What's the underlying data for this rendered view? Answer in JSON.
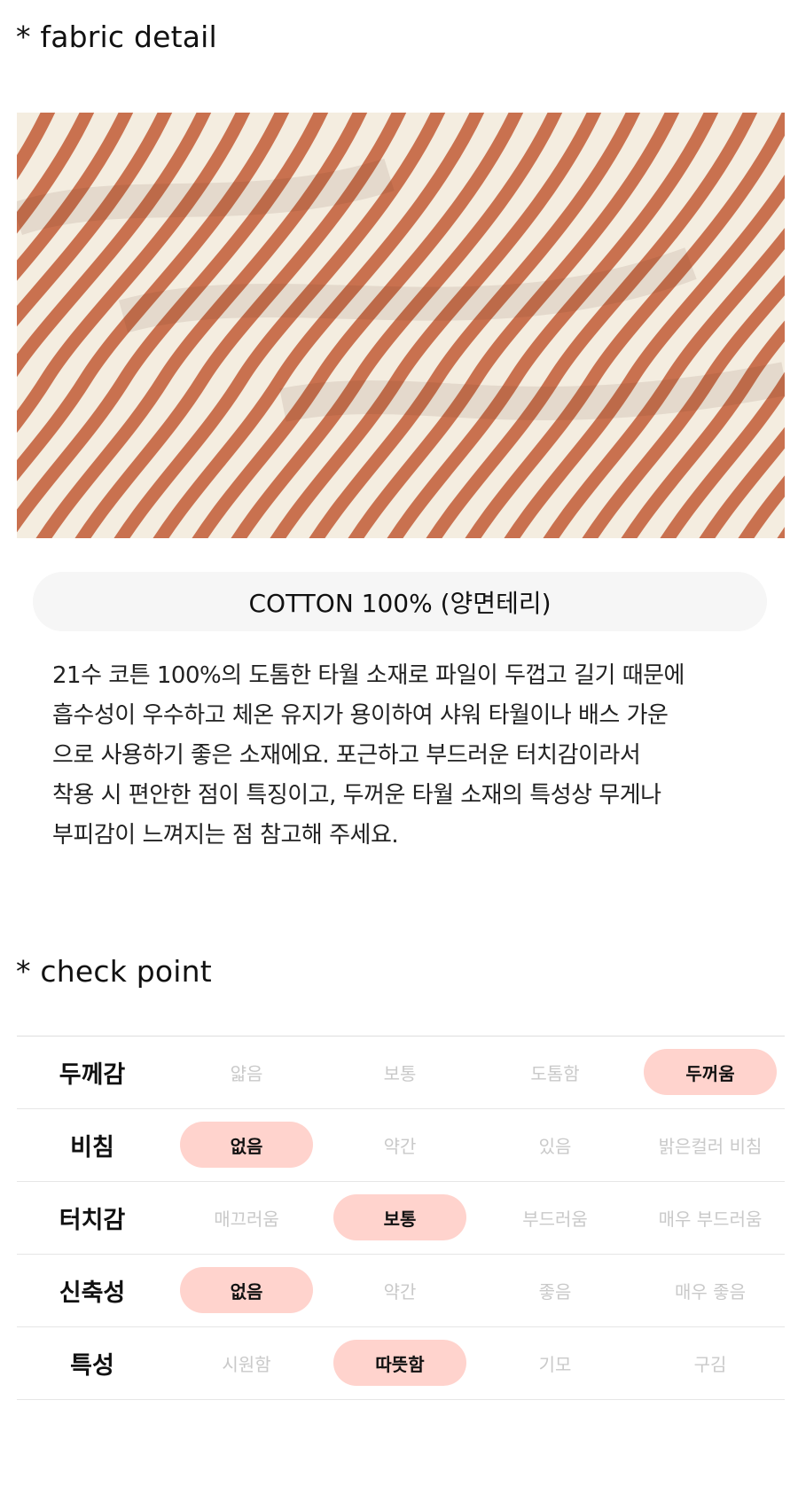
{
  "fabric": {
    "title": "* fabric detail",
    "image_alt": "striped terry cotton fabric",
    "stripe_color": "#c9714f",
    "base_color": "#f4ede0",
    "material_label": "COTTON 100% (양면테리)",
    "description_lines": [
      "21수 코튼 100%의 도톰한 타월 소재로 파일이 두껍고 길기 때문에",
      "흡수성이 우수하고 체온 유지가 용이하여 샤워 타월이나 배스 가운",
      "으로 사용하기 좋은 소재에요. 포근하고 부드러운 터치감이라서",
      "착용 시 편안한 점이 특징이고, 두꺼운 타월 소재의 특성상 무게나",
      "부피감이 느껴지는 점 참고해 주세요."
    ]
  },
  "check": {
    "title": "* check point",
    "highlight_color": "#ffd3cd",
    "rows": [
      {
        "label": "두께감",
        "options": [
          "얇음",
          "보통",
          "도톰함",
          "두꺼움"
        ],
        "selected": 3
      },
      {
        "label": "비침",
        "options": [
          "없음",
          "약간",
          "있음",
          "밝은컬러 비침"
        ],
        "selected": 0
      },
      {
        "label": "터치감",
        "options": [
          "매끄러움",
          "보통",
          "부드러움",
          "매우 부드러움"
        ],
        "selected": 1
      },
      {
        "label": "신축성",
        "options": [
          "없음",
          "약간",
          "좋음",
          "매우 좋음"
        ],
        "selected": 0
      },
      {
        "label": "특성",
        "options": [
          "시원함",
          "따뜻함",
          "기모",
          "구김"
        ],
        "selected": 1
      }
    ]
  }
}
